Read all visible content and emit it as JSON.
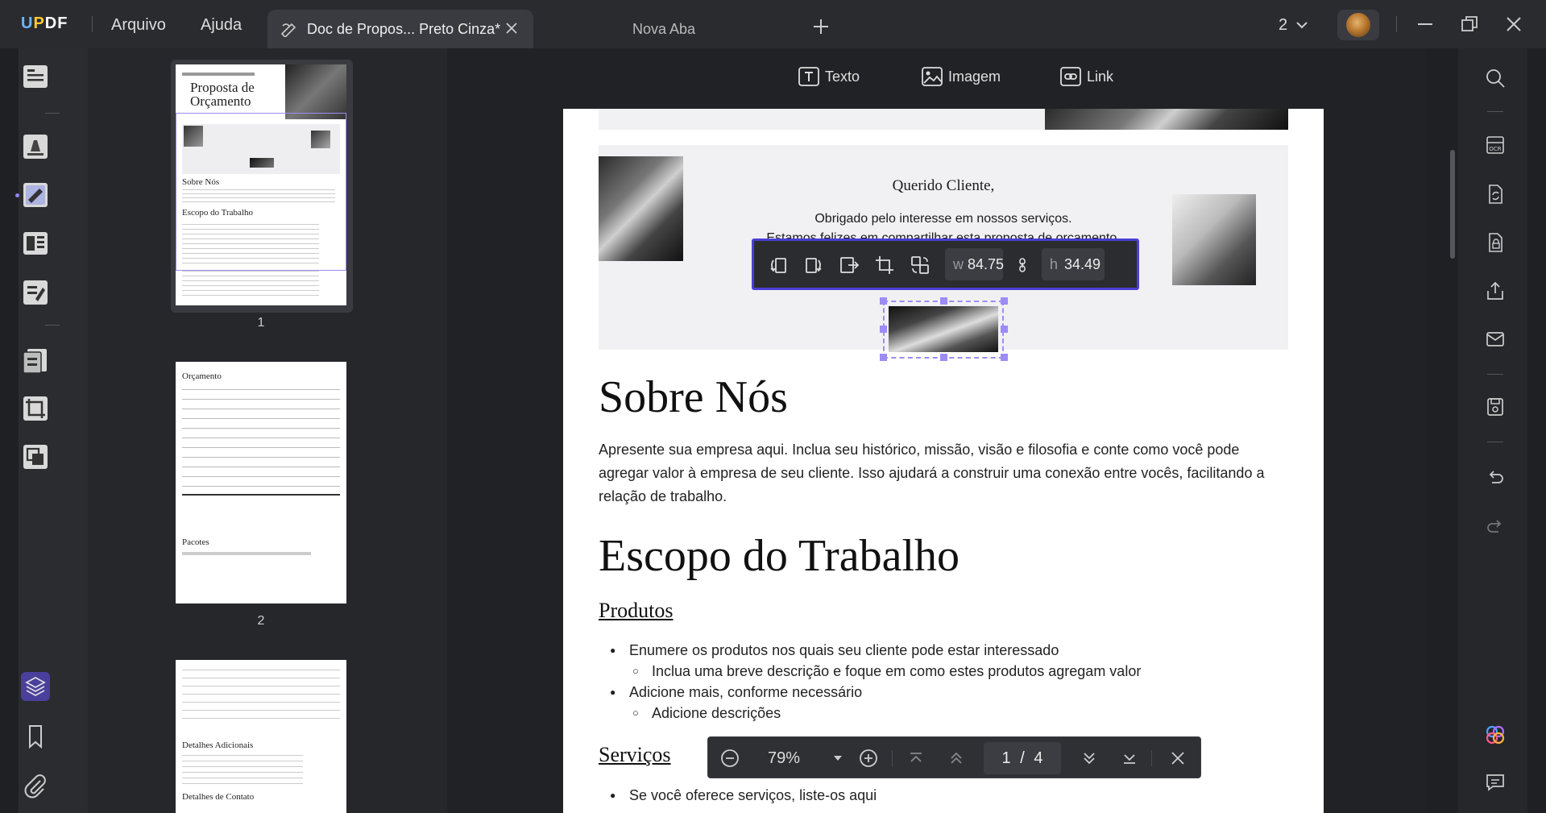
{
  "app": {
    "logo": "UPDF"
  },
  "menu": {
    "file": "Arquivo",
    "help": "Ajuda"
  },
  "tabs": [
    {
      "label": "Doc de Propos... Preto Cinza*",
      "active": true
    },
    {
      "label": "Nova Aba",
      "active": false
    }
  ],
  "header_right": {
    "window_count": "2"
  },
  "edit_toolbar": {
    "text": "Texto",
    "image": "Imagem",
    "link": "Link"
  },
  "thumbnails": [
    {
      "page": "1",
      "heading": "Proposta de Orçamento",
      "sub1": "Sobre Nós",
      "sub2": "Escopo do Trabalho"
    },
    {
      "page": "2",
      "heading": "Orçamento",
      "sub1": "Pacotes"
    },
    {
      "page": "",
      "heading": "Detalhes Adicionais",
      "sub1": "Detalhes de Contato"
    }
  ],
  "document": {
    "greeting": "Querido Cliente,",
    "thanks_line1": "Obrigado pelo interesse em nossos serviços.",
    "thanks_line2": "Estamos felizes em compartilhar esta proposta de orçamento.",
    "section_about": "Sobre Nós",
    "about_text": "Apresente sua empresa aqui. Inclua seu histórico, missão, visão e filosofia e conte como você pode agregar valor à empresa de seu cliente. Isso ajudará a construir uma conexão entre vocês, facilitando a relação de trabalho.",
    "section_scope": "Escopo do Trabalho",
    "products_heading": "Produtos",
    "products": [
      {
        "text": "Enumere os produtos nos quais seu cliente pode estar interessado",
        "level": 1
      },
      {
        "text": "Inclua uma breve descrição e foque em como estes produtos agregam valor",
        "level": 2
      },
      {
        "text": "Adicione mais, conforme necessário",
        "level": 1
      },
      {
        "text": "Adicione descrições",
        "level": 2
      }
    ],
    "services_heading": "Serviços",
    "services_first": "Se você oferece serviços, liste-os aqui"
  },
  "image_toolbar": {
    "w_label": "w",
    "w_value": "84.75",
    "h_label": "h",
    "h_value": "34.49"
  },
  "zoom_bar": {
    "zoom": "79%",
    "page_current": "1",
    "page_sep": "/",
    "page_total": "4"
  },
  "colors": {
    "accent": "#4b3fd6",
    "selection": "#9e8cf5",
    "titlebar": "#2a2b2f"
  }
}
